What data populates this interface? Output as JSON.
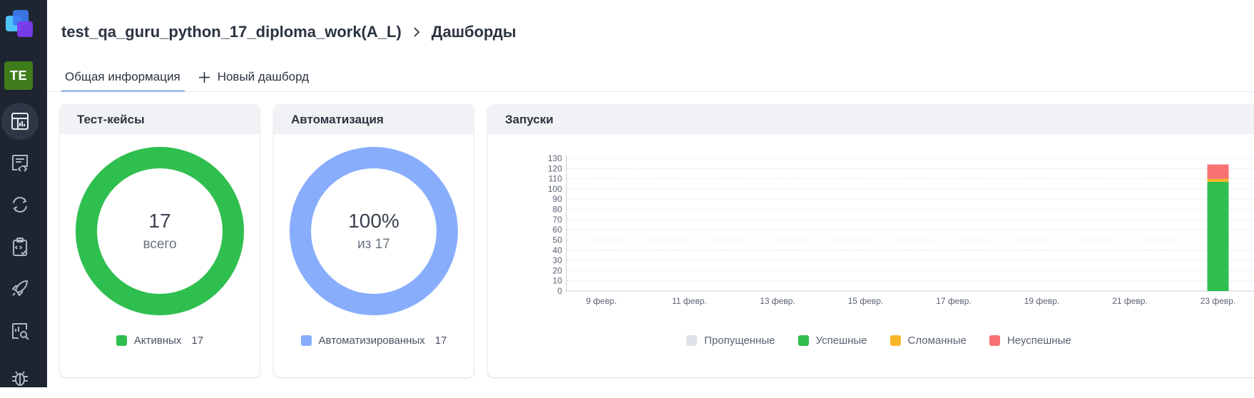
{
  "sidebar": {
    "avatar_initials": "TE",
    "avatar_color": "#3f7c1c",
    "items": [
      {
        "name": "dashboard-icon",
        "active": true
      },
      {
        "name": "testcases-icon",
        "active": false
      },
      {
        "name": "launches-icon",
        "active": false
      },
      {
        "name": "testplans-icon",
        "active": false
      },
      {
        "name": "rocket-icon",
        "active": false
      },
      {
        "name": "analytics-icon",
        "active": false
      },
      {
        "name": "defects-icon",
        "active": false
      }
    ]
  },
  "breadcrumb": {
    "project": "test_qa_guru_python_17_diploma_work(A_L)",
    "page": "Дашборды"
  },
  "tabs": [
    {
      "label": "Общая информация",
      "active": true
    },
    {
      "label": "Новый дашборд",
      "active": false
    }
  ],
  "widgets": {
    "testcases": {
      "title": "Тест-кейсы",
      "value": "17",
      "sub": "всего",
      "legend_label": "Активных",
      "legend_count": "17",
      "color": "#2fbf4f"
    },
    "automation": {
      "title": "Автоматизация",
      "value": "100%",
      "sub": "из 17",
      "legend_label": "Автоматизированных",
      "legend_count": "17",
      "color": "#88adfc"
    },
    "launches": {
      "title": "Запуски"
    }
  },
  "chart_data": {
    "type": "bar",
    "stacked": true,
    "x_ticks": [
      "9 февр.",
      "11 февр.",
      "13 февр.",
      "15 февр.",
      "17 февр.",
      "19 февр.",
      "21 февр.",
      "23 февр."
    ],
    "ylim": [
      0,
      130
    ],
    "y_ticks": [
      0,
      10,
      20,
      30,
      40,
      50,
      60,
      70,
      80,
      90,
      100,
      110,
      120,
      130
    ],
    "grid": true,
    "legend_position": "bottom",
    "series": [
      {
        "name": "Пропущенные",
        "color": "#dde2e8",
        "values": [
          0
        ]
      },
      {
        "name": "Успешные",
        "color": "#2fbf4f",
        "values": [
          107
        ]
      },
      {
        "name": "Сломанные",
        "color": "#fbb52a",
        "values": [
          3
        ]
      },
      {
        "name": "Неуспешные",
        "color": "#f87272",
        "values": [
          14
        ]
      }
    ],
    "bar_categories": [
      "23 февр."
    ]
  }
}
